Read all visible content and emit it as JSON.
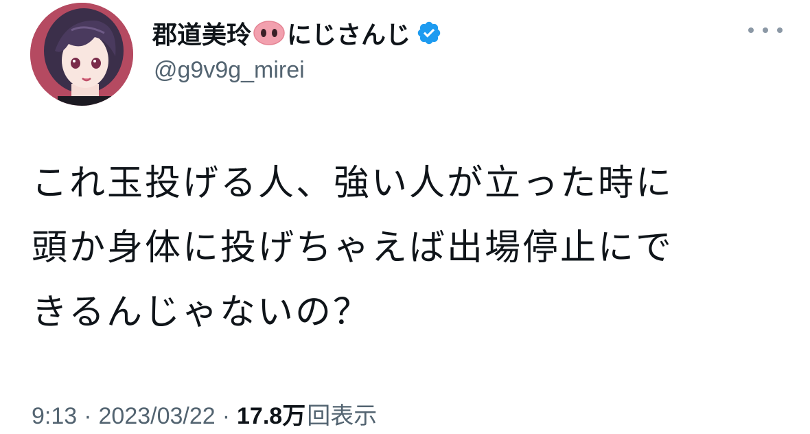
{
  "author": {
    "display_name": "郡道美玲",
    "display_name_suffix": "にじさんじ",
    "handle": "@g9v9g_mirei",
    "avatar_icon": "avatar-illustration",
    "name_emoji_icon": "pig-nose-icon",
    "verified_icon": "verified-badge-icon"
  },
  "tweet": {
    "text": "これ玉投げる人、強い人が立った時に\n頭か身体に投げちゃえば出場停止にで\nきるんじゃないの？"
  },
  "meta": {
    "time": "9:13",
    "separator": "·",
    "date": "2023/03/22",
    "views_count": "17.8万",
    "views_label": "回表示"
  },
  "colors": {
    "verified": "#1d9bf0",
    "secondary_text": "#536471",
    "primary_text": "#0f1419",
    "pig_pink": "#f2a0ae"
  }
}
